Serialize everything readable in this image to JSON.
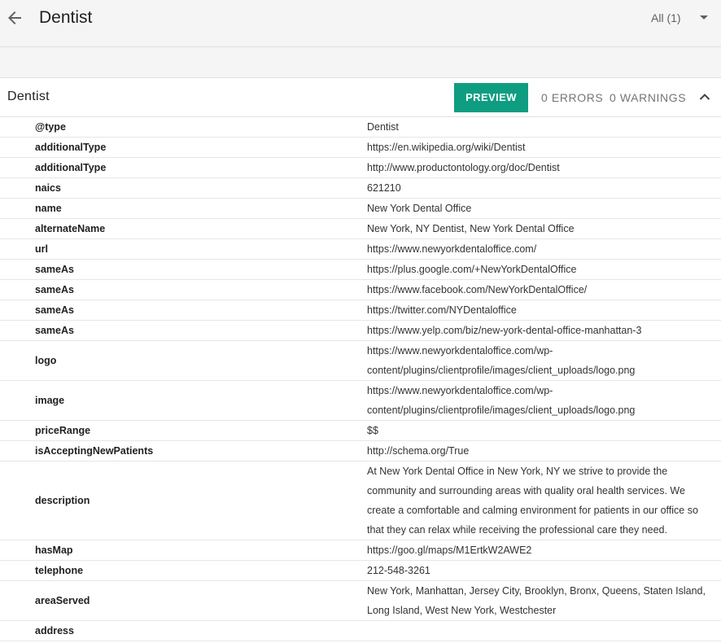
{
  "header": {
    "title": "Dentist",
    "filter_label": "All (1)"
  },
  "section": {
    "title": "Dentist",
    "preview_label": "PREVIEW",
    "errors_label": "0 ERRORS",
    "warnings_label": "0 WARNINGS"
  },
  "colors": {
    "accent": "#0f9d81",
    "toolbar_bg": "#f5f5f5"
  },
  "rows": [
    {
      "key": "@type",
      "value": "Dentist"
    },
    {
      "key": "additionalType",
      "value": "https://en.wikipedia.org/wiki/Dentist"
    },
    {
      "key": "additionalType",
      "value": "http://www.productontology.org/doc/Dentist"
    },
    {
      "key": "naics",
      "value": "621210"
    },
    {
      "key": "name",
      "value": "New York Dental Office"
    },
    {
      "key": "alternateName",
      "value": "New York, NY Dentist, New York Dental Office"
    },
    {
      "key": "url",
      "value": "https://www.newyorkdentaloffice.com/"
    },
    {
      "key": "sameAs",
      "value": "https://plus.google.com/+NewYorkDentalOffice"
    },
    {
      "key": "sameAs",
      "value": "https://www.facebook.com/NewYorkDentalOffice/"
    },
    {
      "key": "sameAs",
      "value": "https://twitter.com/NYDentaloffice"
    },
    {
      "key": "sameAs",
      "value": "https://www.yelp.com/biz/new-york-dental-office-manhattan-3"
    },
    {
      "key": "logo",
      "value": "https://www.newyorkdentaloffice.com/wp-content/plugins/clientprofile/images/client_uploads/logo.png"
    },
    {
      "key": "image",
      "value": "https://www.newyorkdentaloffice.com/wp-content/plugins/clientprofile/images/client_uploads/logo.png"
    },
    {
      "key": "priceRange",
      "value": "$$"
    },
    {
      "key": "isAcceptingNewPatients",
      "value": "http://schema.org/True"
    },
    {
      "key": "description",
      "value": "At New York Dental Office in New York, NY we strive to provide the community and surrounding areas with quality oral health services. We create a comfortable and calming environment for patients in our office so that they can relax while receiving the professional care they need."
    },
    {
      "key": "hasMap",
      "value": "https://goo.gl/maps/M1ErtkW2AWE2"
    },
    {
      "key": "telephone",
      "value": "212-548-3261"
    },
    {
      "key": "areaServed",
      "value": "New York, Manhattan, Jersey City, Brooklyn, Bronx, Queens, Staten Island, Long Island, West New York, Westchester"
    },
    {
      "key": "address",
      "value": ""
    }
  ]
}
